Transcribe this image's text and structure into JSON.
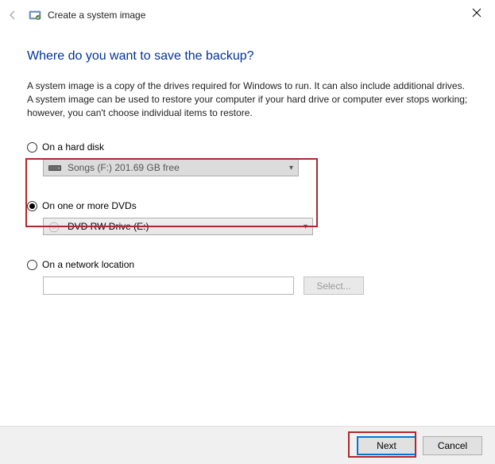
{
  "titlebar": {
    "title": "Create a system image"
  },
  "heading": "Where do you want to save the backup?",
  "description": "A system image is a copy of the drives required for Windows to run. It can also include additional drives. A system image can be used to restore your computer if your hard drive or computer ever stops working; however, you can't choose individual items to restore.",
  "options": {
    "hard_disk": {
      "label": "On a hard disk",
      "selected": "Songs (F:)  201.69 GB free"
    },
    "dvd": {
      "label": "On one or more DVDs",
      "selected": "DVD RW Drive (E:)"
    },
    "network": {
      "label": "On a network location",
      "value": "",
      "select_btn": "Select..."
    }
  },
  "buttons": {
    "next": "Next",
    "cancel": "Cancel"
  }
}
